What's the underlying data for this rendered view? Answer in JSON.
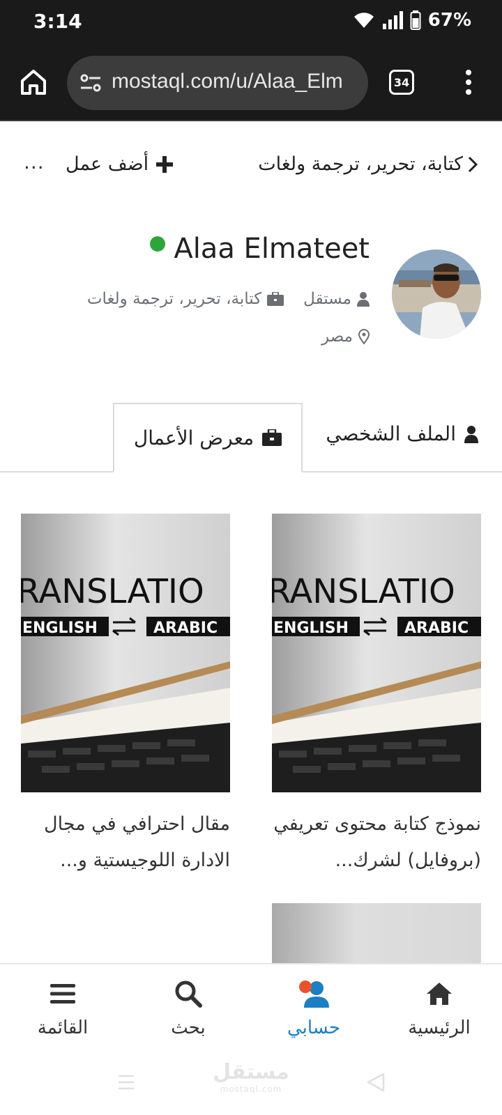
{
  "status_bar": {
    "time": "3:14",
    "battery": "67%"
  },
  "browser": {
    "url": "mostaql.com/u/Alaa_Elm",
    "tab_count": "34"
  },
  "subheader": {
    "category": "كتابة، تحرير، ترجمة ولغات",
    "add_work": "أضف عمل",
    "more": "..."
  },
  "profile": {
    "name": "Alaa Elmateet",
    "online": true,
    "role": "مستقل",
    "category": "كتابة، تحرير، ترجمة ولغات",
    "location": "مصر"
  },
  "tabs": [
    {
      "label": "الملف الشخصي",
      "icon": "user-icon",
      "active": false
    },
    {
      "label": "معرض الأعمال",
      "icon": "briefcase-icon",
      "active": true
    }
  ],
  "portfolio": [
    {
      "title": "نموذج كتابة محتوى تعريفي (بروفايل) لشرك...",
      "image": {
        "line1": "RANSLATIO",
        "lang_left": "ENGLISH",
        "lang_right": "ARABIC"
      }
    },
    {
      "title": "مقال احترافي في مجال الادارة اللوجيستية و...",
      "image": {
        "line1": "RANSLATIO",
        "lang_left": "ENGLISH",
        "lang_right": "ARABIC"
      }
    }
  ],
  "bottom_nav": {
    "home": "الرئيسية",
    "account": "حسابي",
    "search": "بحث",
    "menu": "القائمة"
  },
  "system_nav": {
    "logo_ar": "مستقل",
    "logo_en": "mostaql.com"
  },
  "colors": {
    "accent": "#1c7ec3",
    "online": "#2ea53a",
    "muted": "#6b6f74",
    "account_dot": "#e8532f"
  }
}
